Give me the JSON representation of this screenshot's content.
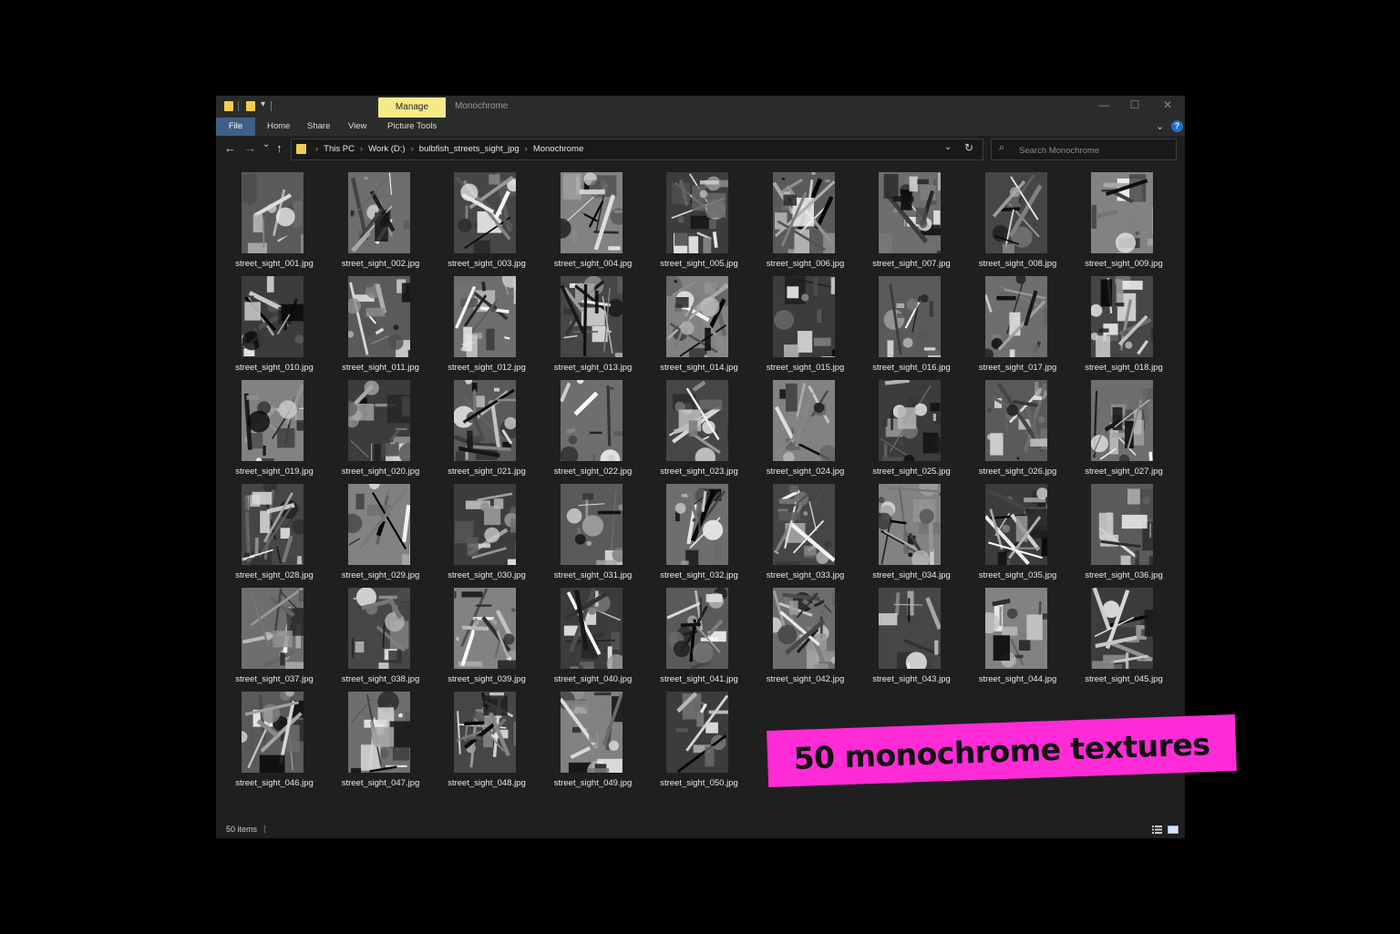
{
  "window": {
    "manage_tab": "Manage",
    "title": "Monochrome",
    "controls": {
      "minimize": "—",
      "maximize": "☐",
      "close": "✕"
    }
  },
  "ribbon": {
    "tabs": [
      "File",
      "Home",
      "Share",
      "View",
      "Picture Tools"
    ]
  },
  "nav": {
    "back": "←",
    "forward": "→",
    "recent": "⌄",
    "up": "↑"
  },
  "address": {
    "crumbs": [
      "This PC",
      "Work (D:)",
      "bulbfish_streets_sight_jpg",
      "Monochrome"
    ],
    "dropdown": "⌄",
    "refresh": "↻"
  },
  "search": {
    "placeholder": "Search Monochrome"
  },
  "files": [
    "street_sight_001.jpg",
    "street_sight_002.jpg",
    "street_sight_003.jpg",
    "street_sight_004.jpg",
    "street_sight_005.jpg",
    "street_sight_006.jpg",
    "street_sight_007.jpg",
    "street_sight_008.jpg",
    "street_sight_009.jpg",
    "street_sight_010.jpg",
    "street_sight_011.jpg",
    "street_sight_012.jpg",
    "street_sight_013.jpg",
    "street_sight_014.jpg",
    "street_sight_015.jpg",
    "street_sight_016.jpg",
    "street_sight_017.jpg",
    "street_sight_018.jpg",
    "street_sight_019.jpg",
    "street_sight_020.jpg",
    "street_sight_021.jpg",
    "street_sight_022.jpg",
    "street_sight_023.jpg",
    "street_sight_024.jpg",
    "street_sight_025.jpg",
    "street_sight_026.jpg",
    "street_sight_027.jpg",
    "street_sight_028.jpg",
    "street_sight_029.jpg",
    "street_sight_030.jpg",
    "street_sight_031.jpg",
    "street_sight_032.jpg",
    "street_sight_033.jpg",
    "street_sight_034.jpg",
    "street_sight_035.jpg",
    "street_sight_036.jpg",
    "street_sight_037.jpg",
    "street_sight_038.jpg",
    "street_sight_039.jpg",
    "street_sight_040.jpg",
    "street_sight_041.jpg",
    "street_sight_042.jpg",
    "street_sight_043.jpg",
    "street_sight_044.jpg",
    "street_sight_045.jpg",
    "street_sight_046.jpg",
    "street_sight_047.jpg",
    "street_sight_048.jpg",
    "street_sight_049.jpg",
    "street_sight_050.jpg"
  ],
  "status": {
    "count": "50 items",
    "separator": "|"
  },
  "promo": {
    "text": "50 monochrome textures"
  },
  "colors": {
    "manage_tab_bg": "#f4eb86",
    "file_tab_bg": "#3f5f86",
    "folder": "#f2cd4d",
    "promo_bg": "#ff2bd6",
    "help": "#1e6fd0"
  }
}
